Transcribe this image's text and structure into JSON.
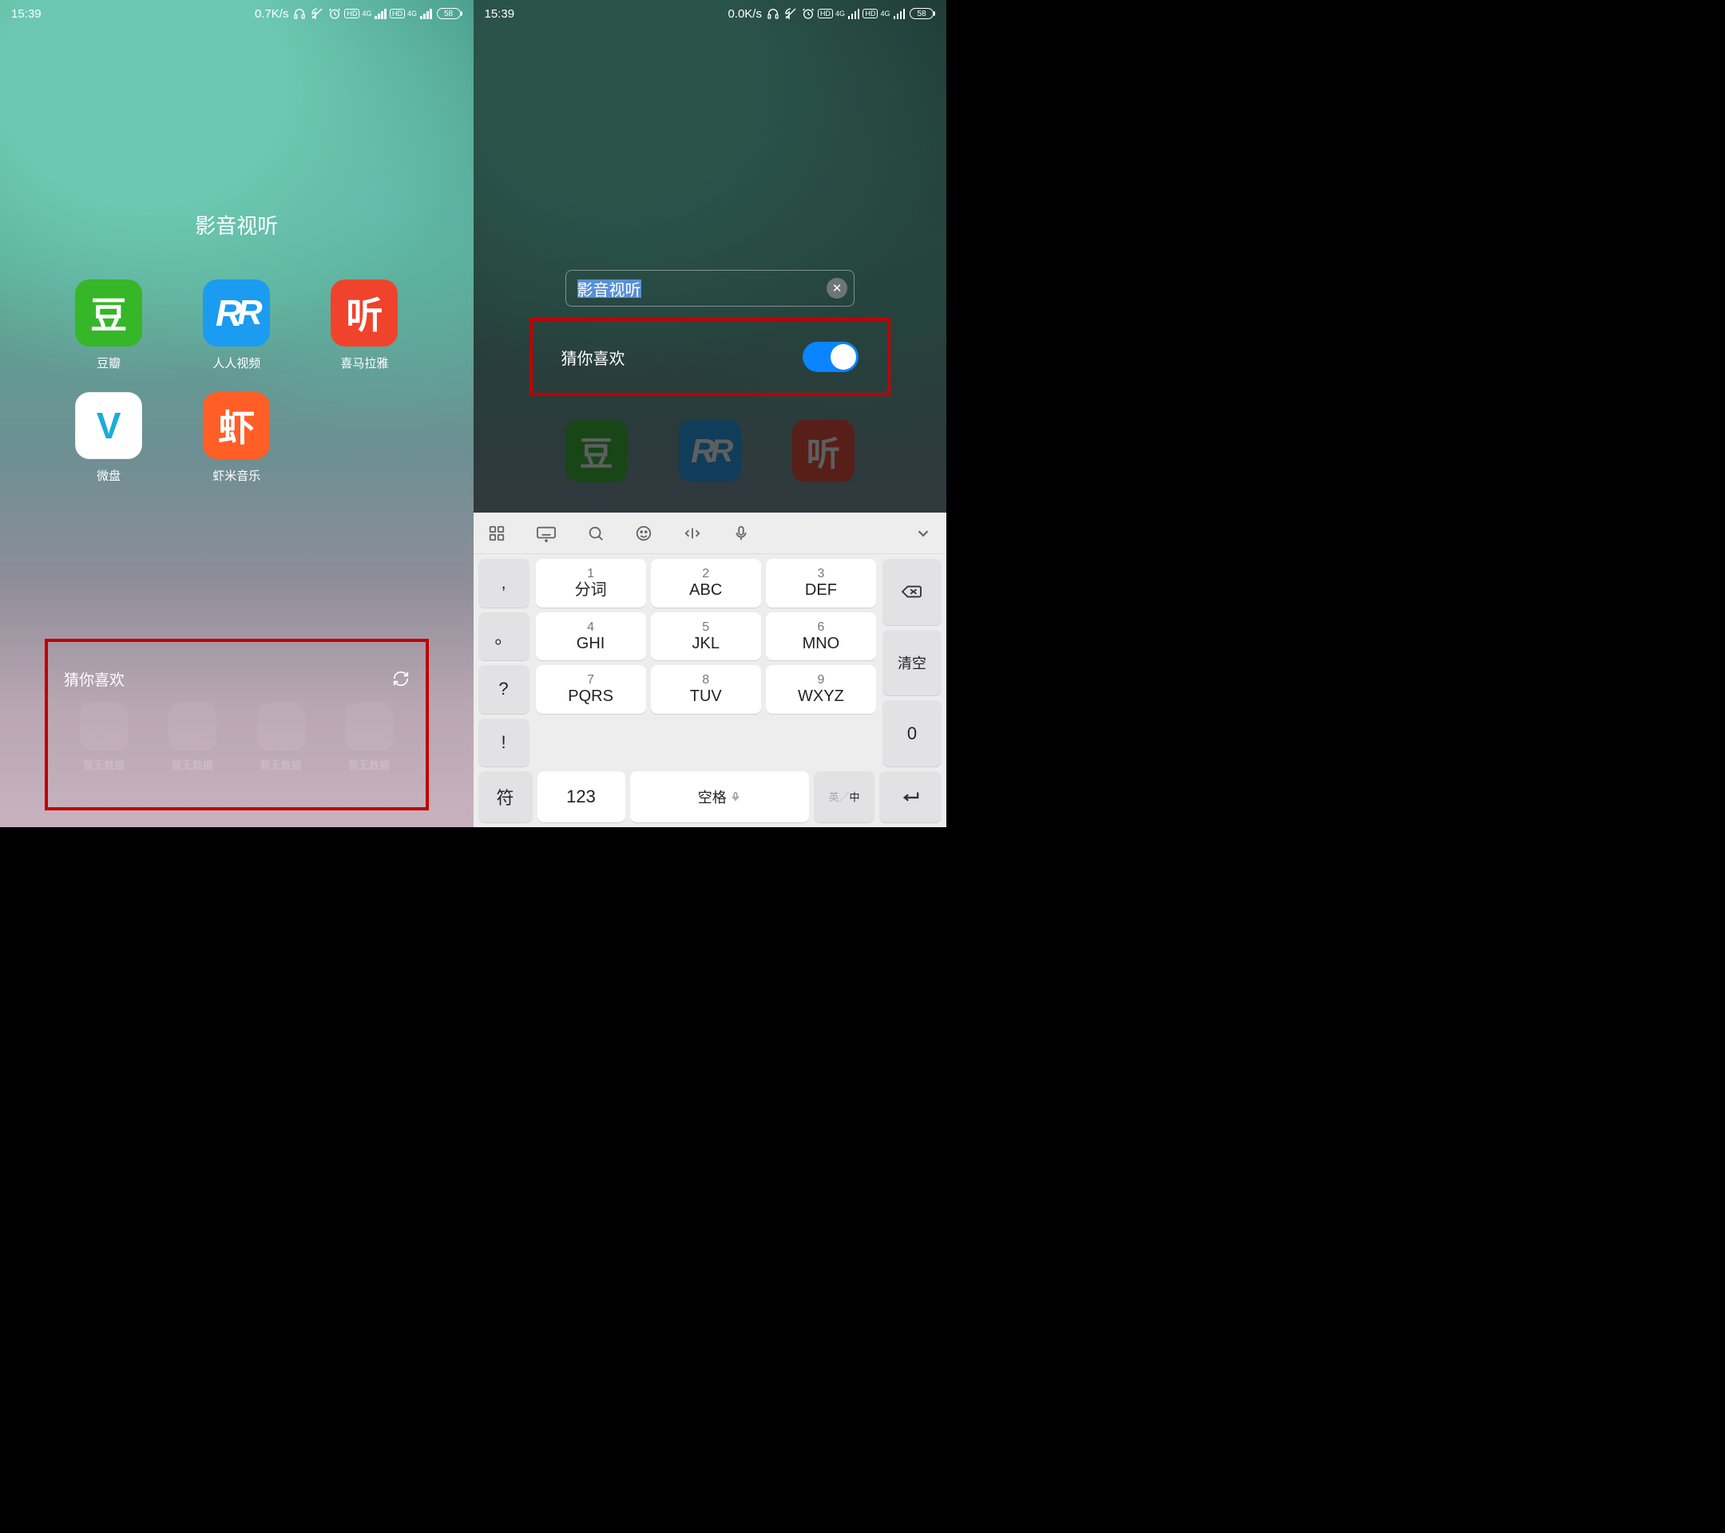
{
  "statusbar": {
    "time": "15:39",
    "speed_left": "0.7K/s",
    "speed_right": "0.0K/s",
    "net_label": "4G",
    "hd_label": "HD",
    "battery": "58"
  },
  "folder": {
    "title": "影音视听",
    "apps": [
      {
        "label": "豆瓣",
        "glyph": "豆",
        "color": "i-green"
      },
      {
        "label": "人人视频",
        "glyph": "R",
        "color": "i-blue"
      },
      {
        "label": "喜马拉雅",
        "glyph": "听",
        "color": "i-red"
      },
      {
        "label": "微盘",
        "glyph": "V",
        "color": "i-cyan"
      },
      {
        "label": "虾米音乐",
        "glyph": "虾",
        "color": "i-orange"
      }
    ]
  },
  "guess": {
    "label": "猜你喜欢",
    "empty": "暂无数据"
  },
  "editor": {
    "value": "影音视听",
    "option_label": "猜你喜欢",
    "toggle_on": true,
    "clear_glyph": "✕"
  },
  "kb": {
    "keys": [
      {
        "num": "1",
        "ltr": "分词"
      },
      {
        "num": "2",
        "ltr": "ABC"
      },
      {
        "num": "3",
        "ltr": "DEF"
      },
      {
        "num": "4",
        "ltr": "GHI"
      },
      {
        "num": "5",
        "ltr": "JKL"
      },
      {
        "num": "6",
        "ltr": "MNO"
      },
      {
        "num": "7",
        "ltr": "PQRS"
      },
      {
        "num": "8",
        "ltr": "TUV"
      },
      {
        "num": "9",
        "ltr": "WXYZ"
      }
    ],
    "left": [
      ",",
      "。",
      "?",
      "!"
    ],
    "right_clear": "清空",
    "right_zero": "0",
    "sym": "符",
    "num123": "123",
    "space": "空格",
    "lang_en": "英",
    "lang_cn": "中"
  }
}
